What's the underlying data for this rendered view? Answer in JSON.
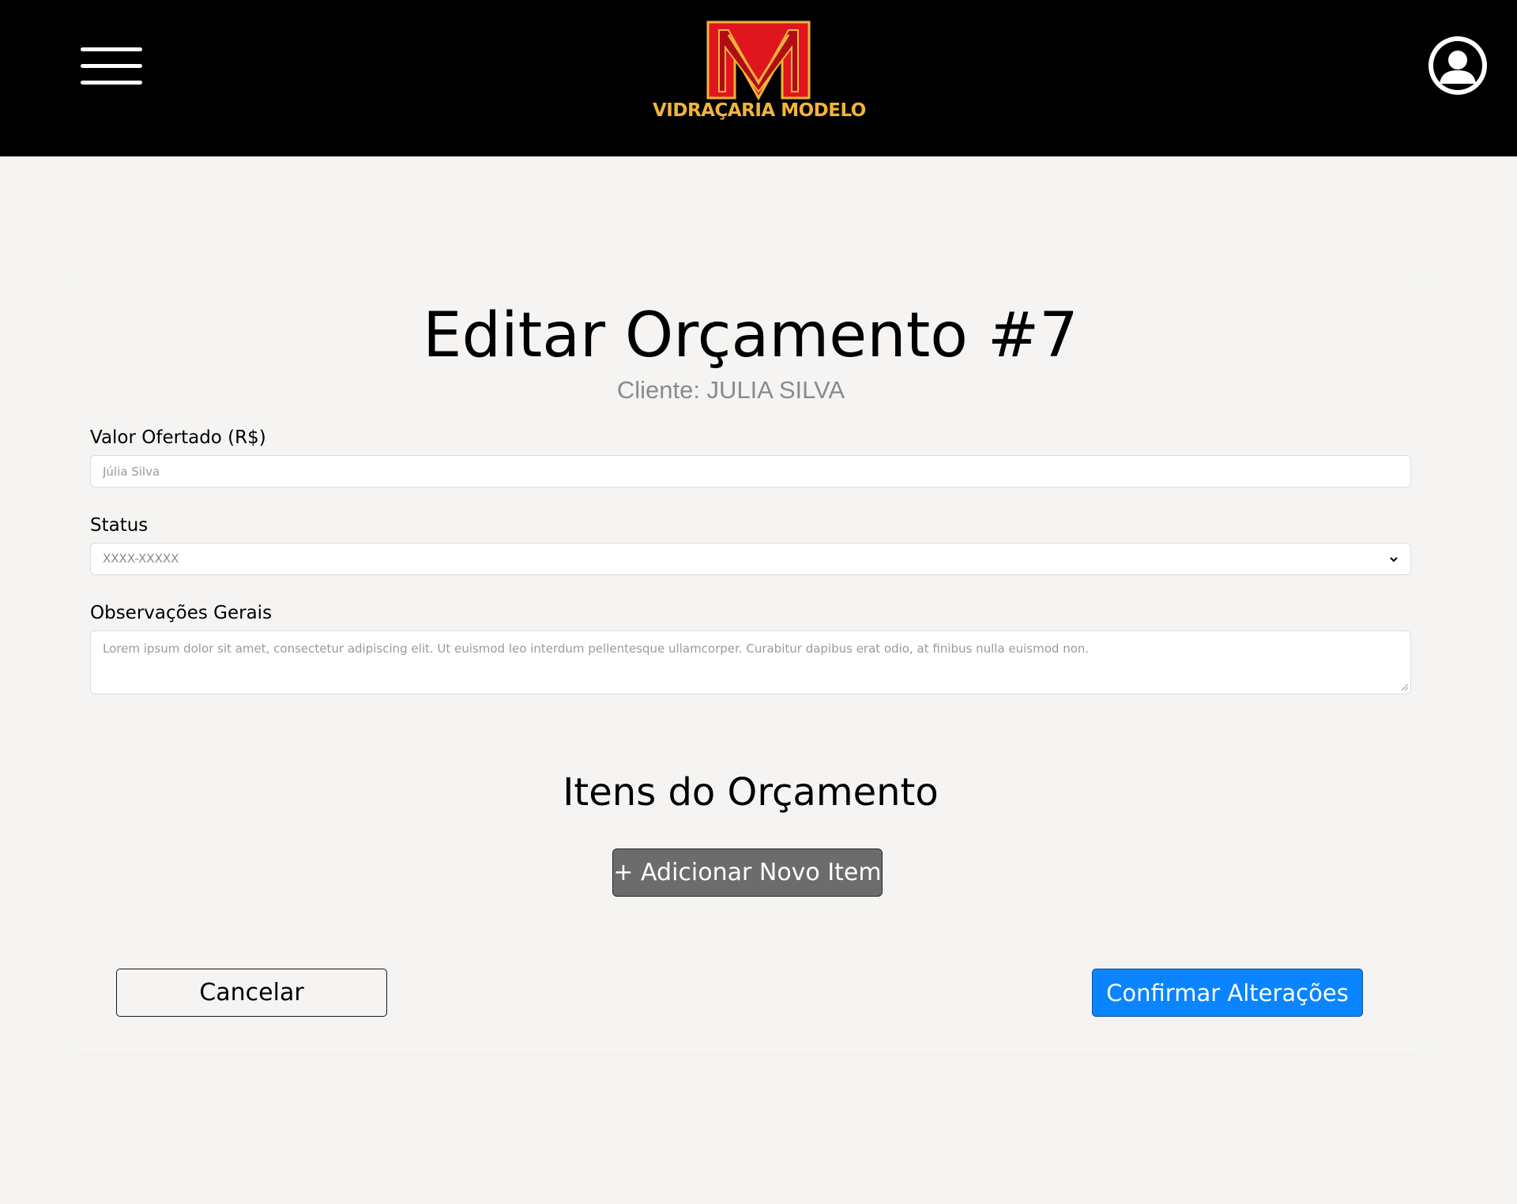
{
  "header": {
    "menu_icon": "hamburger-menu-icon",
    "logo_text": "VIDRAÇARIA MODELO",
    "profile_icon": "user-avatar-icon",
    "colors": {
      "background": "#000000",
      "logo_red": "#e0161e",
      "logo_gold": "#f2b43a"
    }
  },
  "page": {
    "title": "Editar Orçamento #7",
    "subtitle": "Cliente: JULIA SILVA"
  },
  "form": {
    "valor": {
      "label": "Valor Ofertado (R$)",
      "placeholder": "Júlia Silva"
    },
    "status": {
      "label": "Status",
      "selected": "XXXX-XXXXX"
    },
    "observacoes": {
      "label": "Observações Gerais",
      "placeholder": "Lorem ipsum dolor sit amet, consectetur adipiscing elit. Ut euismod leo interdum pellentesque ullamcorper. Curabitur dapibus erat odio, at finibus nulla euismod non."
    }
  },
  "items": {
    "title": "Itens do Orçamento",
    "add_button": "+ Adicionar Novo Item"
  },
  "actions": {
    "cancel": "Cancelar",
    "confirm": "Confirmar Alterações",
    "confirm_color": "#0a84ff"
  }
}
